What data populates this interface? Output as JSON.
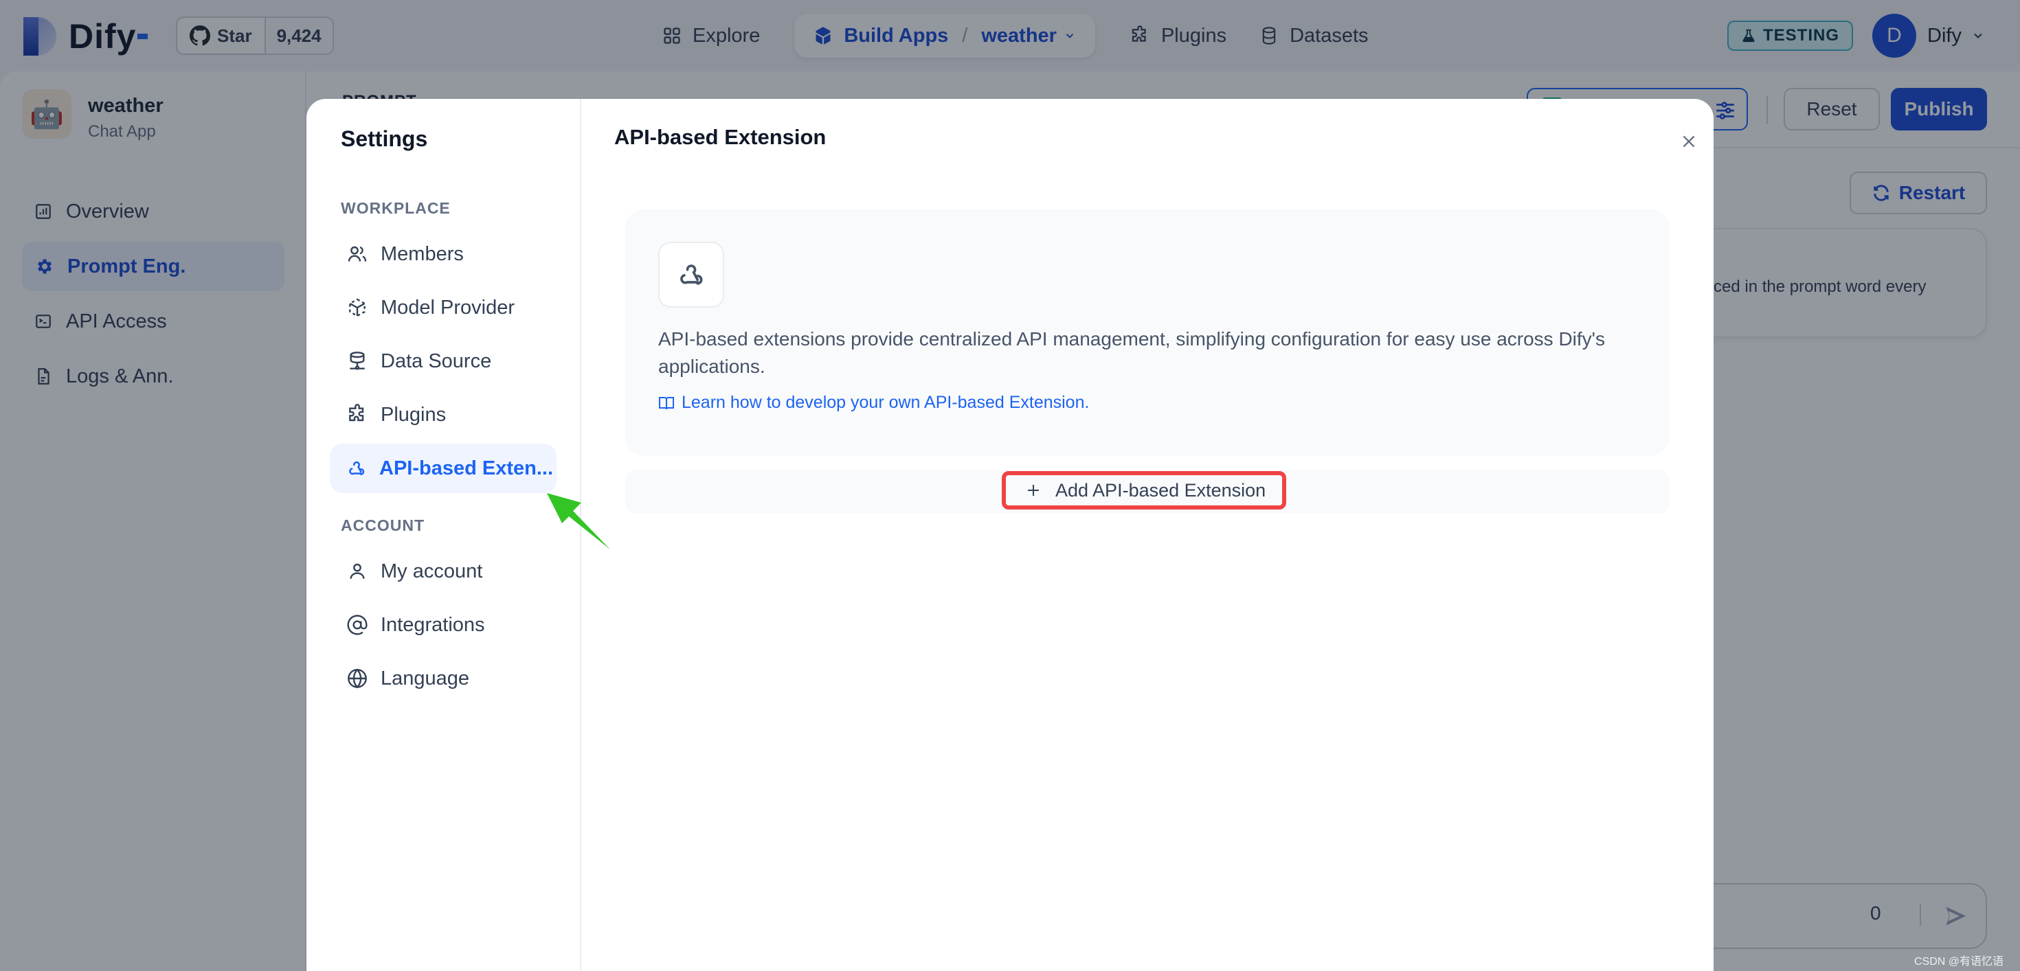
{
  "topbar": {
    "brand": "Dify",
    "github": {
      "star_label": "Star",
      "star_count": "9,424"
    },
    "nav": {
      "explore": "Explore",
      "build_apps": "Build Apps",
      "separator": "/",
      "current_app": "weather",
      "plugins": "Plugins",
      "datasets": "Datasets"
    },
    "env_badge": "TESTING",
    "user": {
      "initial": "D",
      "name": "Dify"
    }
  },
  "app_sidebar": {
    "app_name": "weather",
    "app_type": "Chat App",
    "app_icon": "🤖",
    "items": [
      {
        "label": "Overview",
        "icon": "chart-icon",
        "active": false
      },
      {
        "label": "Prompt Eng.",
        "icon": "gear-icon",
        "active": true
      },
      {
        "label": "API Access",
        "icon": "terminal-icon",
        "active": false
      },
      {
        "label": "Logs & Ann.",
        "icon": "document-icon",
        "active": false
      }
    ]
  },
  "background_page": {
    "section_label": "PROMPT",
    "reset_label": "Reset",
    "publish_label": "Publish",
    "restart_label": "Restart",
    "intro_snippet": "ced in the prompt word every",
    "char_count": "0",
    "watermark": "CSDN @有语忆语"
  },
  "settings_modal": {
    "title": "Settings",
    "groups": [
      {
        "label": "WORKPLACE",
        "items": [
          {
            "label": "Members",
            "icon": "users-icon",
            "active": false
          },
          {
            "label": "Model Provider",
            "icon": "cube-icon",
            "active": false
          },
          {
            "label": "Data Source",
            "icon": "database-icon",
            "active": false
          },
          {
            "label": "Plugins",
            "icon": "puzzle-icon",
            "active": false
          },
          {
            "label": "API-based Exten...",
            "icon": "webhook-icon",
            "active": true
          }
        ]
      },
      {
        "label": "ACCOUNT",
        "items": [
          {
            "label": "My account",
            "icon": "user-icon",
            "active": false
          },
          {
            "label": "Integrations",
            "icon": "at-sign-icon",
            "active": false
          },
          {
            "label": "Language",
            "icon": "globe-icon",
            "active": false
          }
        ]
      }
    ],
    "panel": {
      "title": "API-based Extension",
      "description": "API-based extensions provide centralized API management, simplifying configuration for easy use across Dify's applications.",
      "learn_link": "Learn how to develop your own API-based Extension.",
      "add_button": "Add API-based Extension"
    }
  },
  "colors": {
    "accent": "#1c64f2",
    "primary_button": "#1c4ed8",
    "highlight_box": "#ef4444",
    "annotation_arrow": "#33c426",
    "testing_badge": "#41b5c9"
  }
}
